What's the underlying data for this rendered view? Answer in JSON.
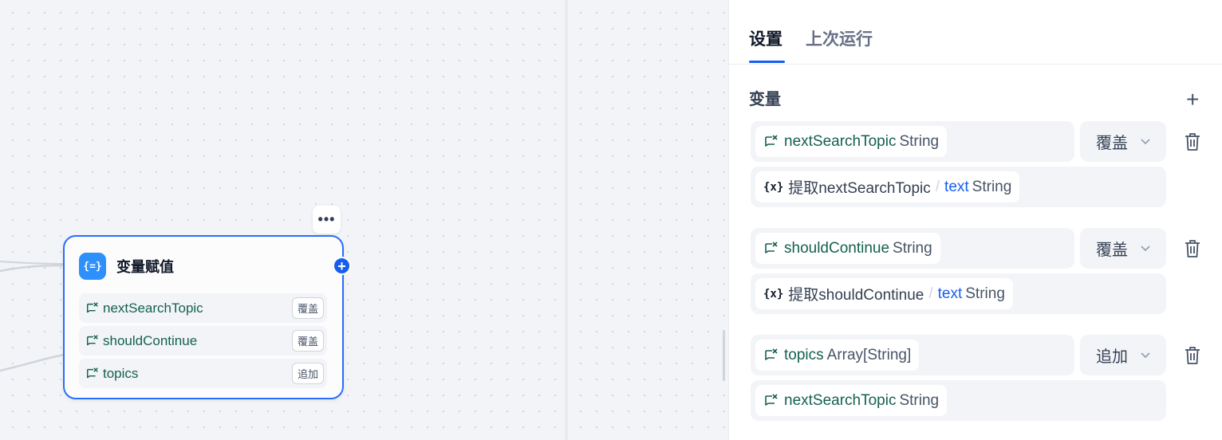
{
  "node": {
    "title": "变量赋值",
    "icon": "variable-assign-icon",
    "more_label": "•••",
    "add_label": "+",
    "rows": [
      {
        "name": "nextSearchTopic",
        "op": "覆盖"
      },
      {
        "name": "shouldContinue",
        "op": "覆盖"
      },
      {
        "name": "topics",
        "op": "追加"
      }
    ]
  },
  "panel": {
    "tabs": {
      "settings": "设置",
      "last_run": "上次运行"
    },
    "section_title": "变量",
    "add_label": "+",
    "items": [
      {
        "target": {
          "name": "nextSearchTopic",
          "type": "String"
        },
        "op": "覆盖",
        "value": {
          "icon": "{x}",
          "node": "提取nextSearchTopic",
          "separator": "/",
          "field": "text",
          "type": "String"
        }
      },
      {
        "target": {
          "name": "shouldContinue",
          "type": "String"
        },
        "op": "覆盖",
        "value": {
          "icon": "{x}",
          "node": "提取shouldContinue",
          "separator": "/",
          "field": "text",
          "type": "String"
        }
      },
      {
        "target": {
          "name": "topics",
          "type": "Array[String]"
        },
        "op": "追加",
        "value": {
          "name": "nextSearchTopic",
          "type": "String"
        }
      }
    ]
  },
  "colors": {
    "accent": "#155eef",
    "node_border": "#296dff",
    "var_text": "#15614f"
  }
}
